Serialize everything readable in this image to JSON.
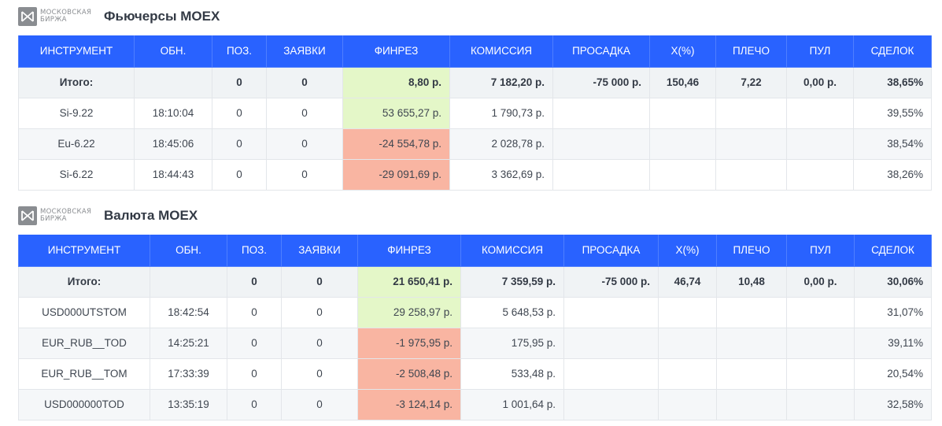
{
  "logo": {
    "line1": "Московская",
    "line2": "Биржа"
  },
  "sections": [
    {
      "title": "Фьючерсы MOEX",
      "columns": [
        "ИНСТРУМЕНТ",
        "ОБН.",
        "ПОЗ.",
        "ЗАЯВКИ",
        "ФИНРЕЗ",
        "КОМИССИЯ",
        "ПРОСАДКА",
        "Х(%)",
        "ПЛЕЧО",
        "ПУЛ",
        "СДЕЛОК"
      ],
      "total": {
        "label": "Итого:",
        "updated": "",
        "position": "0",
        "orders": "0",
        "finres": "8,80 р.",
        "commission": "7 182,20 р.",
        "drawdown": "-75 000 р.",
        "x": "150,46",
        "leverage": "7,22",
        "pool": "0,00 р.",
        "deals": "38,65%"
      },
      "rows": [
        {
          "instrument": "Si-9.22",
          "updated": "18:10:04",
          "position": "0",
          "orders": "0",
          "finres": "53 655,27 р.",
          "commission": "1 790,73 р.",
          "drawdown": "",
          "x": "",
          "leverage": "",
          "pool": "",
          "deals": "39,55%",
          "sign": "pos"
        },
        {
          "instrument": "Eu-6.22",
          "updated": "18:45:06",
          "position": "0",
          "orders": "0",
          "finres": "-24 554,78 р.",
          "commission": "2 028,78 р.",
          "drawdown": "",
          "x": "",
          "leverage": "",
          "pool": "",
          "deals": "38,54%",
          "sign": "neg"
        },
        {
          "instrument": "Si-6.22",
          "updated": "18:44:43",
          "position": "0",
          "orders": "0",
          "finres": "-29 091,69 р.",
          "commission": "3 362,69 р.",
          "drawdown": "",
          "x": "",
          "leverage": "",
          "pool": "",
          "deals": "38,26%",
          "sign": "neg"
        }
      ]
    },
    {
      "title": "Валюта MOEX",
      "columns": [
        "ИНСТРУМЕНТ",
        "ОБН.",
        "ПОЗ.",
        "ЗАЯВКИ",
        "ФИНРЕЗ",
        "КОМИССИЯ",
        "ПРОСАДКА",
        "Х(%)",
        "ПЛЕЧО",
        "ПУЛ",
        "СДЕЛОК"
      ],
      "total": {
        "label": "Итого:",
        "updated": "",
        "position": "0",
        "orders": "0",
        "finres": "21 650,41 р.",
        "commission": "7 359,59 р.",
        "drawdown": "-75 000 р.",
        "x": "46,74",
        "leverage": "10,48",
        "pool": "0,00 р.",
        "deals": "30,06%"
      },
      "rows": [
        {
          "instrument": "USD000UTSTOM",
          "updated": "18:42:54",
          "position": "0",
          "orders": "0",
          "finres": "29 258,97 р.",
          "commission": "5 648,53 р.",
          "drawdown": "",
          "x": "",
          "leverage": "",
          "pool": "",
          "deals": "31,07%",
          "sign": "pos"
        },
        {
          "instrument": "EUR_RUB__TOD",
          "updated": "14:25:21",
          "position": "0",
          "orders": "0",
          "finres": "-1 975,95 р.",
          "commission": "175,95 р.",
          "drawdown": "",
          "x": "",
          "leverage": "",
          "pool": "",
          "deals": "39,11%",
          "sign": "neg"
        },
        {
          "instrument": "EUR_RUB__TOM",
          "updated": "17:33:39",
          "position": "0",
          "orders": "0",
          "finres": "-2 508,48 р.",
          "commission": "533,48 р.",
          "drawdown": "",
          "x": "",
          "leverage": "",
          "pool": "",
          "deals": "20,54%",
          "sign": "neg"
        },
        {
          "instrument": "USD000000TOD",
          "updated": "13:35:19",
          "position": "0",
          "orders": "0",
          "finres": "-3 124,14 р.",
          "commission": "1 001,64 р.",
          "drawdown": "",
          "x": "",
          "leverage": "",
          "pool": "",
          "deals": "32,58%",
          "sign": "neg"
        }
      ]
    }
  ]
}
